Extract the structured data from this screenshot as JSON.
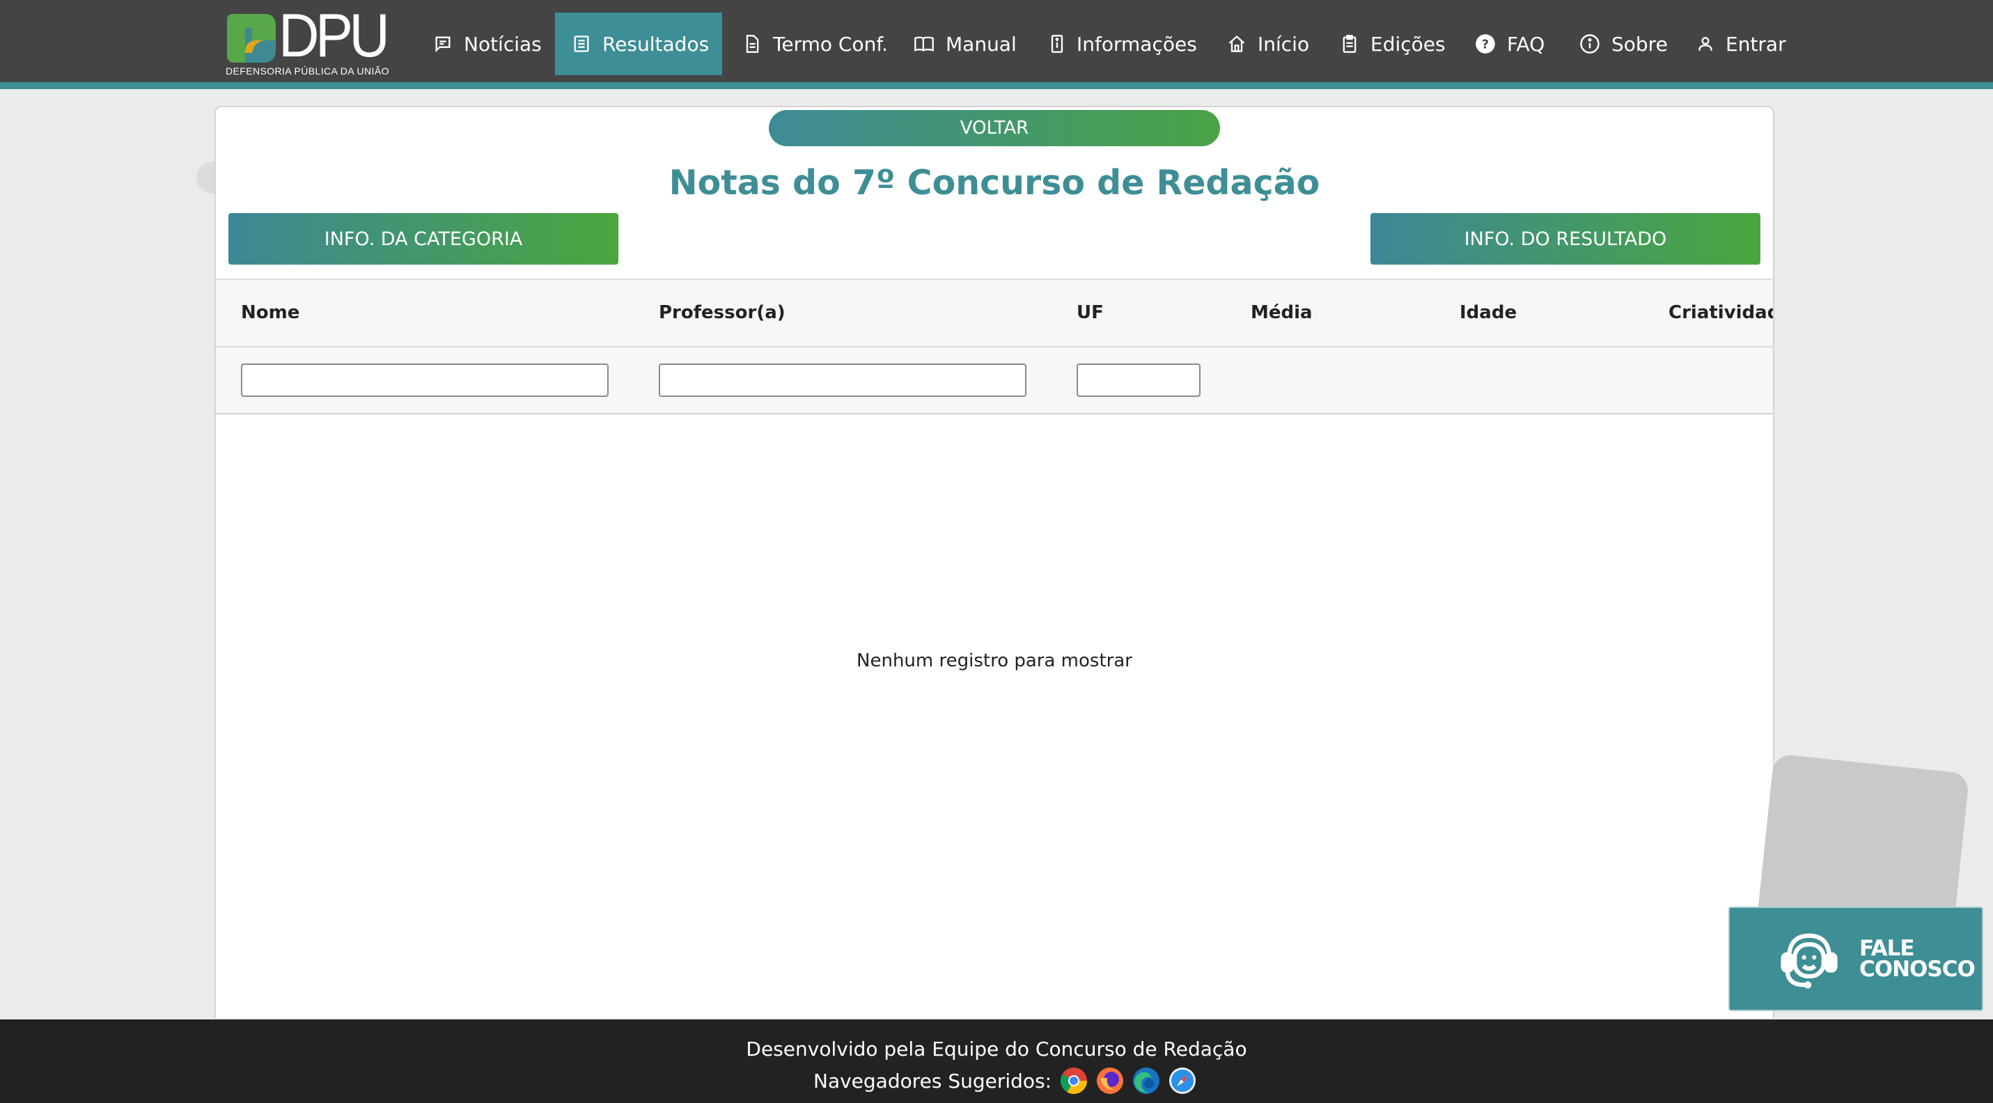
{
  "brand": {
    "logo_text": "DPU",
    "logo_subtitle": "DEFENSORIA PÚBLICA DA UNIÃO",
    "colors": {
      "teal": "#3e8e95",
      "green": "#4aa63d",
      "header_bg": "#444444",
      "footer_bg": "#222222"
    }
  },
  "nav": {
    "noticias": {
      "label": "Notícias",
      "icon": "message-icon"
    },
    "resultados": {
      "label": "Resultados",
      "icon": "list-icon",
      "active": true
    },
    "termo": {
      "label": "Termo Conf.",
      "icon": "document-icon"
    },
    "manual": {
      "label": "Manual",
      "icon": "book-icon"
    },
    "informacoes": {
      "label": "Informações",
      "icon": "info-doc-icon"
    },
    "inicio": {
      "label": "Início",
      "icon": "home-icon"
    },
    "edicoes": {
      "label": "Edições",
      "icon": "clipboard-icon"
    },
    "faq": {
      "label": "FAQ",
      "icon": "help-icon"
    },
    "sobre": {
      "label": "Sobre",
      "icon": "info-icon"
    },
    "entrar": {
      "label": "Entrar",
      "icon": "user-icon"
    }
  },
  "page": {
    "back_label": "VOLTAR",
    "title": "Notas do 7º Concurso de Redação",
    "category_info_label": "INFO. DA CATEGORIA",
    "result_info_label": "INFO. DO RESULTADO"
  },
  "table": {
    "columns": [
      "Nome",
      "Professor(a)",
      "UF",
      "Média",
      "Idade",
      "Criatividade"
    ],
    "filters": {
      "nome": "",
      "professor": "",
      "uf": ""
    },
    "rows": [],
    "empty_message": "Nenhum registro para mostrar"
  },
  "contact": {
    "line1": "FALE",
    "line2": "CONOSCO"
  },
  "footer": {
    "developed_by": "Desenvolvido pela Equipe do Concurso de Redação",
    "suggested_browsers_label": "Navegadores Sugeridos:",
    "browsers": [
      "chrome-icon",
      "firefox-icon",
      "edge-icon",
      "safari-icon"
    ]
  }
}
